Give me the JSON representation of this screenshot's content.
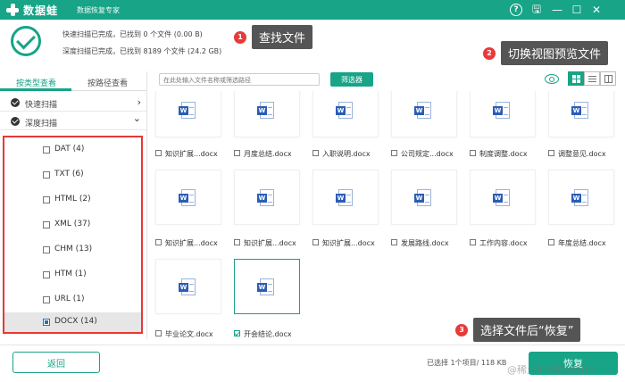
{
  "titlebar": {
    "app_name": "数据蛙",
    "subtitle": "数据恢复专家",
    "help_glyph": "?",
    "save_glyph": "🖫",
    "min_glyph": "—",
    "max_glyph": "☐",
    "close_glyph": "✕"
  },
  "status": {
    "quick_scan": "快速扫描已完成，已找到 0 个文件 (0.00  B)",
    "deep_scan": "深度扫描已完成，已找到 8189 个文件 (24.2 GB)"
  },
  "callouts": [
    {
      "num": "1",
      "text": "查找文件"
    },
    {
      "num": "2",
      "text": "切换视图预览文件"
    },
    {
      "num": "3",
      "text": "选择文件后“恢复”"
    }
  ],
  "left_panel": {
    "tabs": [
      "按类型查看",
      "按路径查看"
    ],
    "quick_scan": "快速扫描",
    "deep_scan": "深度扫描",
    "chevron_right": "›",
    "chevron_down": "⌄",
    "types": [
      "DAT (4)",
      "TXT (6)",
      "HTML (2)",
      "XML (37)",
      "CHM (13)",
      "HTM (1)",
      "URL (1)",
      "DOCX (14)"
    ]
  },
  "toolbar": {
    "search_placeholder": "在此处输入文件名称或筛选路径",
    "filter_label": "筛选器"
  },
  "files": [
    {
      "name": "知识扩展...docx",
      "checked": false
    },
    {
      "name": "月度总结.docx",
      "checked": false
    },
    {
      "name": "入职说明.docx",
      "checked": false
    },
    {
      "name": "公司规定...docx",
      "checked": false
    },
    {
      "name": "制度调整.docx",
      "checked": false
    },
    {
      "name": "调整意见.docx",
      "checked": false
    },
    {
      "name": "知识扩展...docx",
      "checked": false
    },
    {
      "name": "知识扩展...docx",
      "checked": false
    },
    {
      "name": "知识扩展...docx",
      "checked": false
    },
    {
      "name": "发展路线.docx",
      "checked": false
    },
    {
      "name": "工作内容.docx",
      "checked": false
    },
    {
      "name": "年度总结.docx",
      "checked": false
    },
    {
      "name": "毕业论文.docx",
      "checked": false
    },
    {
      "name": "开会结论.docx",
      "checked": true
    }
  ],
  "bottom": {
    "back_label": "返回",
    "selection_text": "已选择 1个项目/ 118 KB",
    "recover_label": "恢复",
    "watermark": "@稀土掘金技术社区"
  }
}
